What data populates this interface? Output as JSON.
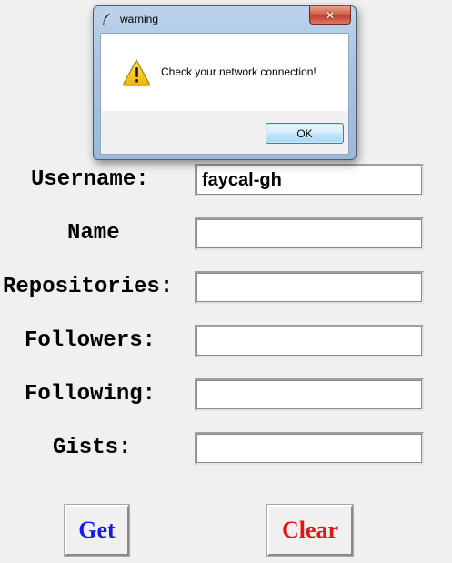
{
  "form": {
    "username_label": "Username:",
    "username_value": "faycal-gh",
    "name_label": "Name",
    "name_value": "",
    "repositories_label": "Repositories:",
    "repositories_value": "",
    "followers_label": "Followers:",
    "followers_value": "",
    "following_label": "Following:",
    "following_value": "",
    "gists_label": "Gists:",
    "gists_value": ""
  },
  "buttons": {
    "get_label": "Get",
    "get_color": "#1a1ae6",
    "clear_label": "Clear",
    "clear_color": "#e61414"
  },
  "dialog": {
    "title": "warning",
    "message": "Check your network connection!",
    "ok_label": "OK",
    "icons": {
      "title": "feather-icon",
      "message": "warning-icon",
      "close": "close-icon"
    }
  }
}
